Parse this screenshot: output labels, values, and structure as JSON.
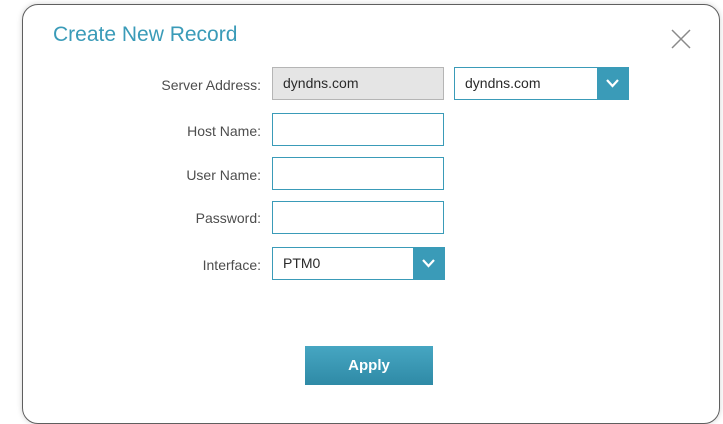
{
  "dialog": {
    "title": "Create New Record",
    "close_icon": "close-icon"
  },
  "form": {
    "server_address": {
      "label": "Server Address:",
      "value": "dyndns.com",
      "select_value": "dyndns.com"
    },
    "host_name": {
      "label": "Host Name:",
      "value": ""
    },
    "user_name": {
      "label": "User Name:",
      "value": ""
    },
    "password": {
      "label": "Password:",
      "value": ""
    },
    "interface": {
      "label": "Interface:",
      "select_value": "PTM0"
    }
  },
  "actions": {
    "apply_label": "Apply"
  },
  "colors": {
    "accent": "#3a9bb8",
    "readonly_bg": "#e5e5e5",
    "label_text": "#4d4d4d"
  }
}
